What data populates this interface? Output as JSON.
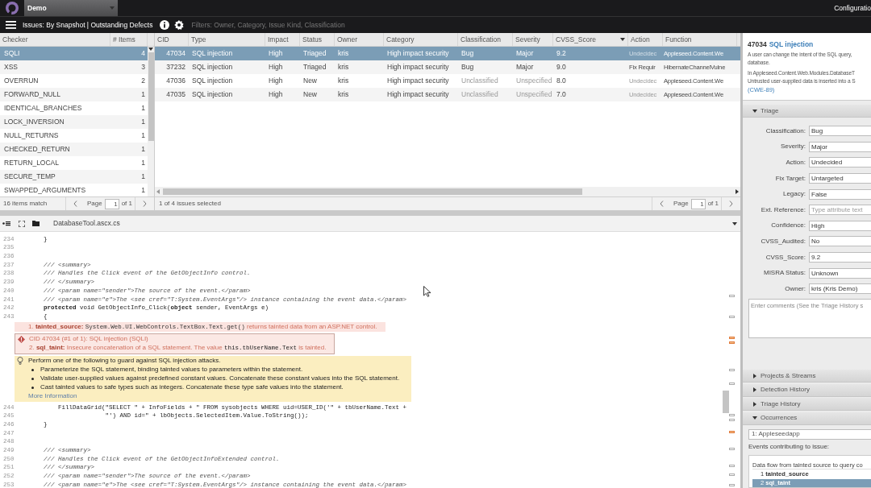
{
  "top_bar": {
    "project": "Demo",
    "right_link": "Configuratio"
  },
  "toolbar": {
    "title": "Issues: By Snapshot | Outstanding Defects",
    "filters": "Filters: Owner, Category, Issue Kind, Classification"
  },
  "checker_table": {
    "columns": [
      "Checker",
      "# Items"
    ],
    "rows": [
      {
        "name": "SQLI",
        "count": "4",
        "selected": true
      },
      {
        "name": "XSS",
        "count": "3",
        "selected": false
      },
      {
        "name": "OVERRUN",
        "count": "2",
        "selected": false
      },
      {
        "name": "FORWARD_NULL",
        "count": "1",
        "selected": false
      },
      {
        "name": "IDENTICAL_BRANCHES",
        "count": "1",
        "selected": false
      },
      {
        "name": "LOCK_INVERSION",
        "count": "1",
        "selected": false
      },
      {
        "name": "NULL_RETURNS",
        "count": "1",
        "selected": false
      },
      {
        "name": "CHECKED_RETURN",
        "count": "1",
        "selected": false
      },
      {
        "name": "RETURN_LOCAL",
        "count": "1",
        "selected": false
      },
      {
        "name": "SECURE_TEMP",
        "count": "1",
        "selected": false
      },
      {
        "name": "SWAPPED_ARGUMENTS",
        "count": "1",
        "selected": false
      }
    ],
    "footer": "16 items match",
    "page_label": "Page",
    "page": "1",
    "page_of": "of 1"
  },
  "issue_table": {
    "columns": [
      "CID",
      "Type",
      "Impact",
      "Status",
      "Owner",
      "Category",
      "Classification",
      "Severity",
      "CVSS_Score",
      "Action",
      "Function"
    ],
    "rows": [
      {
        "selected": true,
        "cells": [
          {
            "t": "47034",
            "dim": false
          },
          {
            "t": "SQL injection",
            "dim": false
          },
          {
            "t": "High",
            "dim": false
          },
          {
            "t": "Triaged",
            "dim": false
          },
          {
            "t": "kris",
            "dim": false
          },
          {
            "t": "High impact security",
            "dim": false
          },
          {
            "t": "Bug",
            "dim": false
          },
          {
            "t": "Major",
            "dim": false
          },
          {
            "t": "9.2",
            "dim": false
          },
          {
            "t": "Undecidec",
            "dim": true
          },
          {
            "t": "Appleseed.Content.We",
            "dim": false
          }
        ]
      },
      {
        "selected": false,
        "cells": [
          {
            "t": "37232",
            "dim": false
          },
          {
            "t": "SQL injection",
            "dim": false
          },
          {
            "t": "High",
            "dim": false
          },
          {
            "t": "Triaged",
            "dim": false
          },
          {
            "t": "kris",
            "dim": false
          },
          {
            "t": "High impact security",
            "dim": false
          },
          {
            "t": "Bug",
            "dim": false
          },
          {
            "t": "Major",
            "dim": false
          },
          {
            "t": "9.0",
            "dim": false
          },
          {
            "t": "Fix Requir",
            "dim": false
          },
          {
            "t": "HibernateChannelVulne",
            "dim": false
          }
        ]
      },
      {
        "selected": false,
        "cells": [
          {
            "t": "47036",
            "dim": false
          },
          {
            "t": "SQL injection",
            "dim": false
          },
          {
            "t": "High",
            "dim": false
          },
          {
            "t": "New",
            "dim": false
          },
          {
            "t": "kris",
            "dim": false
          },
          {
            "t": "High impact security",
            "dim": false
          },
          {
            "t": "Unclassified",
            "dim": true
          },
          {
            "t": "Unspecified",
            "dim": true
          },
          {
            "t": "8.0",
            "dim": false
          },
          {
            "t": "Undecidec",
            "dim": true
          },
          {
            "t": "Appleseed.Content.We",
            "dim": false
          }
        ]
      },
      {
        "selected": false,
        "cells": [
          {
            "t": "47035",
            "dim": false
          },
          {
            "t": "SQL injection",
            "dim": false
          },
          {
            "t": "High",
            "dim": false
          },
          {
            "t": "New",
            "dim": false
          },
          {
            "t": "kris",
            "dim": false
          },
          {
            "t": "High impact security",
            "dim": false
          },
          {
            "t": "Unclassified",
            "dim": true
          },
          {
            "t": "Unspecified",
            "dim": true
          },
          {
            "t": "7.0",
            "dim": false
          },
          {
            "t": "Undecidec",
            "dim": true
          },
          {
            "t": "Appleseed.Content.We",
            "dim": false
          }
        ]
      }
    ],
    "footer": "1 of 4 issues selected",
    "page_label": "Page",
    "page": "1",
    "page_of": "of 1"
  },
  "source": {
    "file": "DatabaseTool.ascx.cs",
    "lines": [
      {
        "kind": "code",
        "n": "234",
        "text": "    }"
      },
      {
        "kind": "code",
        "n": "235"
      },
      {
        "kind": "code",
        "n": "236"
      },
      {
        "kind": "comment",
        "n": "237",
        "text": "    /// <summary>"
      },
      {
        "kind": "comment",
        "n": "238",
        "text": "    /// Handles the Click event of the GetObjectInfo control."
      },
      {
        "kind": "comment",
        "n": "239",
        "text": "    /// </summary>"
      },
      {
        "kind": "comment",
        "n": "240",
        "text": "    /// <param name=\"sender\">The source of the event.</param>"
      },
      {
        "kind": "comment",
        "n": "241",
        "text": "    /// <param name=\"e\">The <see cref=\"T:System.EventArgs\"/> instance containing the event data.</param>"
      },
      {
        "kind": "code",
        "n": "242",
        "text": "    **protected** void GetObjectInfo_Click(**object** sender, EventArgs e)"
      },
      {
        "kind": "code",
        "n": "243",
        "text": "    {"
      },
      {
        "kind": "event",
        "number": "1.",
        "tag": "tainted_source:",
        "code": "System.Web.UI.WebControls.TextBox.Text.get()",
        "text": "returns tainted data from an ASP.NET control."
      },
      {
        "kind": "defect",
        "title": "CID 47034 (#1 of 1): SQL injection (SQLI)",
        "number": "2.",
        "tag": "sql_taint:",
        "text": "Insecure concatenation of a SQL statement. The value",
        "code": "this.tbUserName.Text",
        "tail": "is tainted."
      },
      {
        "kind": "remedy",
        "text": "Perform one of the following to guard against SQL injection attacks.",
        "bullets": [
          "Parameterize the SQL statement, binding tainted values to parameters within the statement.",
          "Validate user-supplied values against predefined constant values. Concatenate these constant values into the SQL statement.",
          "Cast tainted values to safe types such as integers. Concatenate these type safe values into the statement."
        ],
        "link": "More Information"
      },
      {
        "kind": "code",
        "n": "244",
        "text": "        FillDataGrid(\"SELECT \" + InfoFields + \" FROM sysobjects WHERE uid=USER_ID('\" + tbUserName.Text +"
      },
      {
        "kind": "code",
        "n": "245",
        "text": "                     \"') AND id=\" + lbObjects.SelectedItem.Value.ToString());"
      },
      {
        "kind": "code",
        "n": "246",
        "text": "    }"
      },
      {
        "kind": "code",
        "n": "247"
      },
      {
        "kind": "code",
        "n": "248"
      },
      {
        "kind": "comment",
        "n": "249",
        "text": "    /// <summary>"
      },
      {
        "kind": "comment",
        "n": "250",
        "text": "    /// Handles the Click event of the GetObjectInfoExtended control."
      },
      {
        "kind": "comment",
        "n": "251",
        "text": "    /// </summary>"
      },
      {
        "kind": "comment",
        "n": "252",
        "text": "    /// <param name=\"sender\">The source of the event.</param>"
      },
      {
        "kind": "comment",
        "n": "253",
        "text": "    /// <param name=\"e\">The <see cref=\"T:System.EventArgs\"/> instance containing the event data.</param>"
      }
    ]
  },
  "detail": {
    "cid": "47034",
    "title": "SQL injection",
    "description": [
      "A user can change the intent of the SQL query,",
      "database."
    ],
    "location": [
      "In Appleseed.Content.Web.Modules.DatabaseT",
      "Untrusted user-supplied data is inserted into a S"
    ],
    "cwe": "(CWE-89)",
    "sections": [
      {
        "kind": "triage",
        "title": "Triage",
        "expanded": true
      },
      {
        "kind": "plain",
        "title": "Projects & Streams",
        "expanded": false
      },
      {
        "kind": "plain",
        "title": "Detection History",
        "expanded": false
      },
      {
        "kind": "plain",
        "title": "Triage History",
        "expanded": false
      },
      {
        "kind": "occurrences",
        "title": "Occurrences",
        "expanded": true
      }
    ],
    "triage_fields": [
      {
        "label": "Classification:",
        "value": "Bug"
      },
      {
        "label": "Severity:",
        "value": "Major"
      },
      {
        "label": "Action:",
        "value": "Undecided"
      },
      {
        "label": "Fix Target:",
        "value": "Untargeted"
      },
      {
        "label": "Legacy:",
        "value": "False"
      },
      {
        "label": "Ext. Reference:",
        "placeholder": "Type attribute text"
      },
      {
        "label": "Confidence:",
        "value": "High"
      },
      {
        "label": "CVSS_Audited:",
        "value": "No"
      },
      {
        "label": "CVSS_Score:",
        "value": "9.2"
      },
      {
        "label": "MISRA Status:",
        "value": "Unknown"
      },
      {
        "label": "Owner:",
        "value": "kris (Kris Demo)"
      }
    ],
    "comments_placeholder": "Enter comments (See the Triage History s",
    "occurrence": "1: Appleseedapp",
    "events_label": "Events contributing to issue:",
    "events_heading": "Data flow from tainted source to query co",
    "events": [
      {
        "n": "1",
        "name": "tainted_source",
        "selected": false
      },
      {
        "n": "2",
        "name": "sql_taint",
        "selected": true
      }
    ]
  }
}
